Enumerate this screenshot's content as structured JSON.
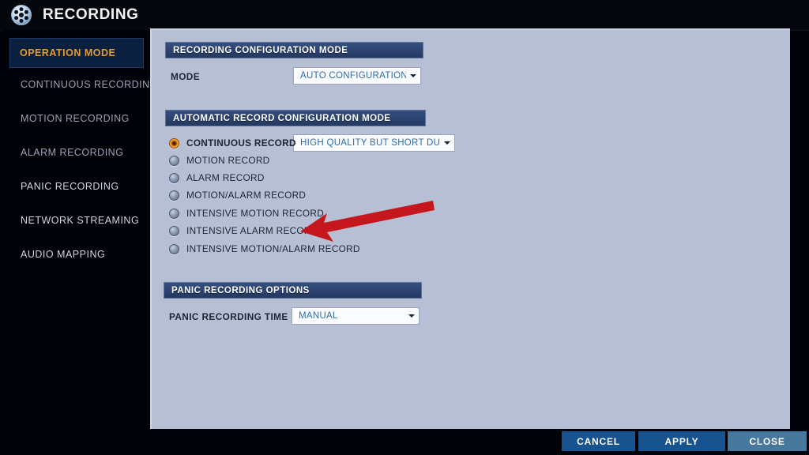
{
  "window": {
    "title": "RECORDING",
    "icon": "film-reel-icon"
  },
  "sidebar": {
    "items": [
      {
        "label": "OPERATION MODE",
        "active": true,
        "dim": false
      },
      {
        "label": "CONTINUOUS RECORDING",
        "active": false,
        "dim": true
      },
      {
        "label": "MOTION RECORDING",
        "active": false,
        "dim": true
      },
      {
        "label": "ALARM RECORDING",
        "active": false,
        "dim": true
      },
      {
        "label": "PANIC RECORDING",
        "active": false,
        "dim": false
      },
      {
        "label": "NETWORK STREAMING",
        "active": false,
        "dim": false
      },
      {
        "label": "AUDIO MAPPING",
        "active": false,
        "dim": false
      }
    ]
  },
  "main": {
    "section_recording_config": {
      "header": "RECORDING CONFIGURATION MODE",
      "mode_label": "MODE",
      "mode_value": "AUTO CONFIGURATION"
    },
    "section_auto_record": {
      "header": "AUTOMATIC RECORD CONFIGURATION MODE",
      "quality_value": "HIGH QUALITY BUT SHORT DURA...",
      "options": [
        {
          "label": "CONTINUOUS RECORD",
          "selected": true
        },
        {
          "label": "MOTION RECORD",
          "selected": false
        },
        {
          "label": "ALARM RECORD",
          "selected": false
        },
        {
          "label": "MOTION/ALARM RECORD",
          "selected": false
        },
        {
          "label": "INTENSIVE MOTION RECORD",
          "selected": false
        },
        {
          "label": "INTENSIVE ALARM RECORD",
          "selected": false
        },
        {
          "label": "INTENSIVE MOTION/ALARM RECORD",
          "selected": false
        }
      ]
    },
    "section_panic": {
      "header": "PANIC RECORDING OPTIONS",
      "time_label": "PANIC RECORDING TIME",
      "time_value": "MANUAL"
    }
  },
  "annotation": {
    "name": "red-arrow-pointing-to-intensive-alarm-record",
    "color": "#c4161c",
    "points_to": "INTENSIVE ALARM RECORD"
  },
  "footer": {
    "buttons": [
      {
        "label": "CANCEL",
        "style": "primary"
      },
      {
        "label": "APPLY",
        "style": "primary"
      },
      {
        "label": "CLOSE",
        "style": "muted"
      }
    ]
  },
  "colors": {
    "panel_bg": "#b7bfd4",
    "section_header": "#2b4371",
    "accent_orange": "#e39b32",
    "dropdown_text": "#2f6ca8",
    "annotation_red": "#c4161c",
    "button_primary": "#17538f",
    "button_muted": "#46779c"
  }
}
